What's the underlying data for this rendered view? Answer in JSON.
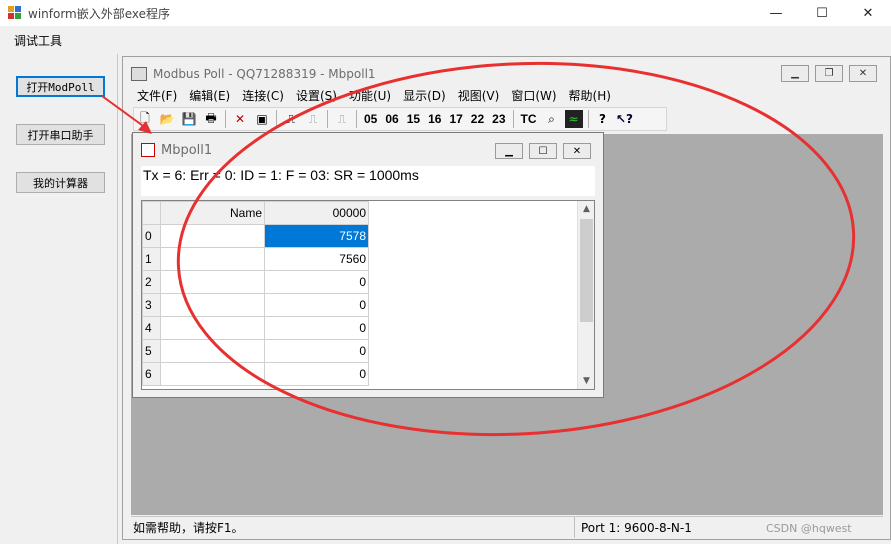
{
  "window": {
    "title": "winform嵌入外部exe程序",
    "minimize": "—",
    "maximize": "☐",
    "close": "✕"
  },
  "menu": {
    "tools": "调试工具"
  },
  "buttons": {
    "open_modpoll": "打开ModPoll",
    "open_serial": "打开串口助手",
    "my_calculator": "我的计算器"
  },
  "modbus": {
    "title": "Modbus Poll - QQ71288319 - Mbpoll1",
    "menu": [
      "文件(F)",
      "编辑(E)",
      "连接(C)",
      "设置(S)",
      "功能(U)",
      "显示(D)",
      "视图(V)",
      "窗口(W)",
      "帮助(H)"
    ],
    "toolbar_codes": [
      "05",
      "06",
      "15",
      "16",
      "17",
      "22",
      "23",
      "TC"
    ],
    "status_help": "如需帮助，请按F1。",
    "status_port": "Port 1: 9600-8-N-1"
  },
  "child": {
    "title": "Mbpoll1",
    "info": "Tx = 6: Err = 0: ID = 1: F = 03: SR = 1000ms",
    "col_name": "Name",
    "col_value": "00000",
    "rows": [
      {
        "index": "0",
        "value": "7578"
      },
      {
        "index": "1",
        "value": "7560"
      },
      {
        "index": "2",
        "value": "0"
      },
      {
        "index": "3",
        "value": "0"
      },
      {
        "index": "4",
        "value": "0"
      },
      {
        "index": "5",
        "value": "0"
      },
      {
        "index": "6",
        "value": "0"
      }
    ]
  },
  "watermark": "CSDN @hqwest",
  "colors": {
    "annotation": "#e83030",
    "selection": "#0078d7",
    "mdi_background": "#ababab"
  }
}
